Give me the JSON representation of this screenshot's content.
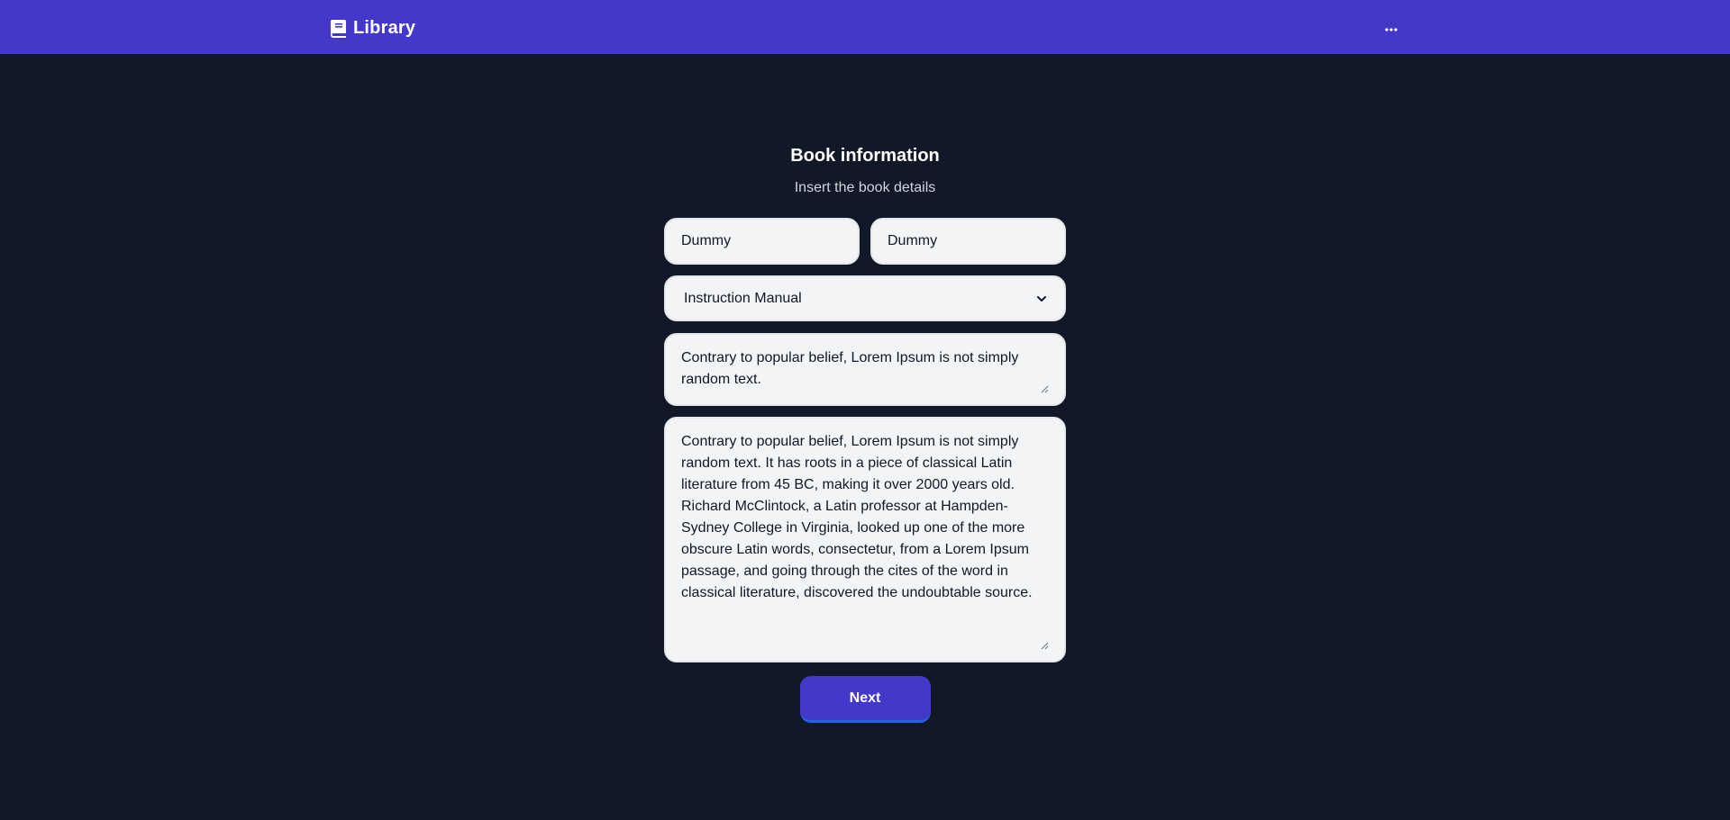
{
  "navbar": {
    "brand_label": "Library",
    "brand_icon": "book-icon",
    "more_icon": "more-horizontal-icon"
  },
  "form": {
    "title": "Book information",
    "subtitle": "Insert the book details",
    "field_1_value": "Dummy",
    "field_2_value": "Dummy",
    "category_selected": "Instruction Manual",
    "short_description_value": "Contrary to popular belief, Lorem Ipsum is not simply random text.",
    "long_description_value": "Contrary to popular belief, Lorem Ipsum is not simply random text. It has roots in a piece of classical Latin literature from 45 BC, making it over 2000 years old. Richard McClintock, a Latin professor at Hampden-Sydney College in Virginia, looked up one of the more obscure Latin words, consectetur, from a Lorem Ipsum passage, and going through the cites of the word in classical literature, discovered the undoubtable source.",
    "next_label": "Next"
  },
  "colors": {
    "navbar": "#4338ca",
    "background": "#111827",
    "field_background": "#f3f4f6",
    "button_background": "#4338ca",
    "button_accent": "#2563eb"
  }
}
